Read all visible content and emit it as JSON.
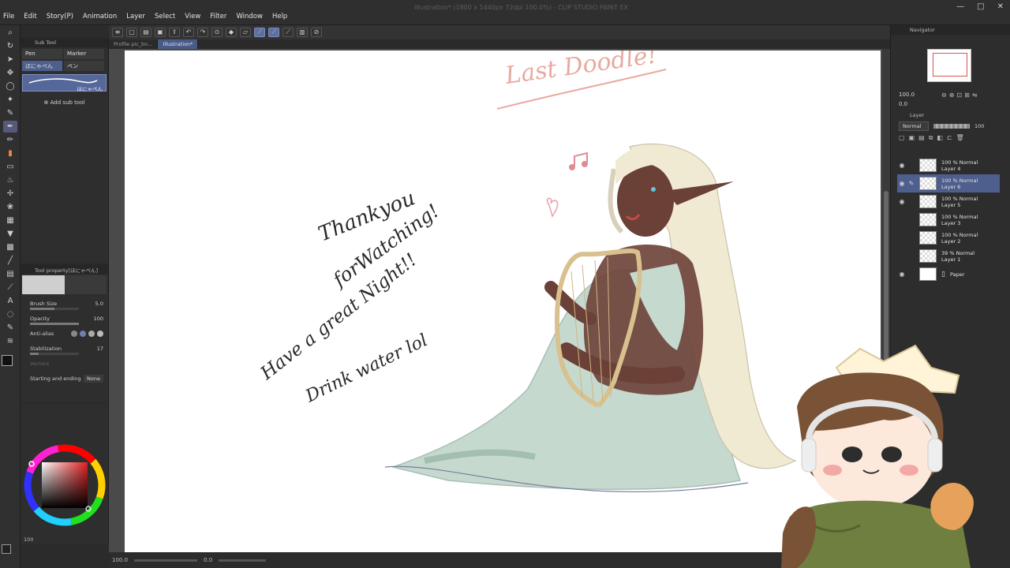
{
  "window": {
    "title": "Illustration* (1800 x 1440px 72dpi 100.0%) - CLIP STUDIO PAINT EX",
    "controls": [
      "—",
      "□",
      "✕"
    ]
  },
  "menu": [
    "File",
    "Edit",
    "Story(P)",
    "Animation",
    "Layer",
    "Select",
    "View",
    "Filter",
    "Window",
    "Help"
  ],
  "tabs": [
    {
      "label": "Profile pic_bn..."
    },
    {
      "label": "Illustration*",
      "active": true
    }
  ],
  "subtool": {
    "header": "Sub Tool",
    "groups": [
      "Pen",
      "Marker",
      "ほにゃぺん",
      "ペン"
    ],
    "selected_brush": "ほにゃぺん",
    "add_label": "Add sub tool"
  },
  "tool_property": {
    "header": "Tool property[ほにゃぺん]",
    "rows": [
      {
        "label": "Brush Size",
        "value": "5.0"
      },
      {
        "label": "Opacity",
        "value": "100"
      },
      {
        "label": "Anti-alias",
        "value": ""
      },
      {
        "label": "Stabilization",
        "value": "17"
      },
      {
        "label": "Vectors",
        "value": ""
      },
      {
        "label": "Starting and ending",
        "value": "None"
      }
    ],
    "levels": {
      "brush_size": 0.5,
      "opacity": 1.0,
      "stabilization": 0.17
    }
  },
  "navigator": {
    "header": "Navigator",
    "zoom": "100.0",
    "rotation": "0.0"
  },
  "layers": {
    "header": "Layer",
    "blend_mode": "Normal",
    "opacity": "100",
    "items": [
      {
        "meta": "100 % Normal",
        "name": "Layer 4",
        "visible": true
      },
      {
        "meta": "100 % Normal",
        "name": "Layer 6",
        "visible": true,
        "selected": true
      },
      {
        "meta": "100 % Normal",
        "name": "Layer 5",
        "visible": true
      },
      {
        "meta": "100 % Normal",
        "name": "Layer 3",
        "visible": false
      },
      {
        "meta": "100 % Normal",
        "name": "Layer 2",
        "visible": false
      },
      {
        "meta": "39 % Normal",
        "name": "Layer 1",
        "visible": false
      },
      {
        "meta": "",
        "name": "Paper",
        "visible": true,
        "paper": true
      }
    ]
  },
  "canvas_text": {
    "title": "Last Doodle!",
    "line1": "Thankyou",
    "line2": "forWatching!",
    "line3": "Have a great Night!!",
    "line4": "Drink water lol"
  },
  "status": {
    "zoom": "100.0",
    "angle": "0.0"
  },
  "color_bottom": {
    "zoom": "100"
  },
  "colors": {
    "accent": "#5c6f9e",
    "title_pink": "#e9a9a0",
    "skin": "#6b4036",
    "dress": "#c6d9cf",
    "hair": "#f1ead2"
  }
}
